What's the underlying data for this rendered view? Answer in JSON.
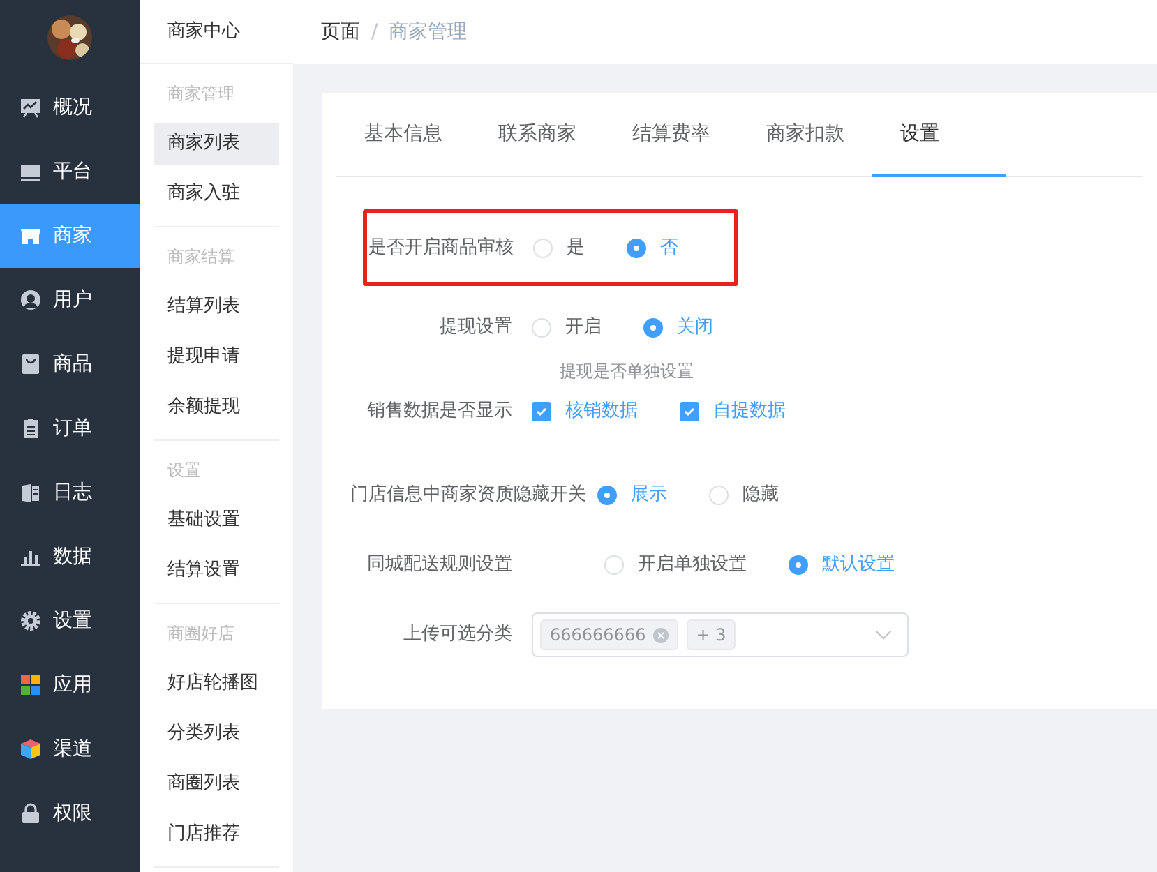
{
  "sidebar": {
    "items": [
      {
        "label": "概况",
        "selected": false
      },
      {
        "label": "平台",
        "selected": false
      },
      {
        "label": "商家",
        "selected": true
      },
      {
        "label": "用户",
        "selected": false
      },
      {
        "label": "商品",
        "selected": false
      },
      {
        "label": "订单",
        "selected": false
      },
      {
        "label": "日志",
        "selected": false
      },
      {
        "label": "数据",
        "selected": false
      },
      {
        "label": "设置",
        "selected": false
      },
      {
        "label": "应用",
        "selected": false
      },
      {
        "label": "渠道",
        "selected": false
      },
      {
        "label": "权限",
        "selected": false
      }
    ]
  },
  "submenu": {
    "title": "商家中心",
    "groups": [
      {
        "title": "商家管理",
        "items": [
          {
            "label": "商家列表",
            "selected": true
          },
          {
            "label": "商家入驻",
            "selected": false
          }
        ]
      },
      {
        "title": "商家结算",
        "items": [
          {
            "label": "结算列表",
            "selected": false
          },
          {
            "label": "提现申请",
            "selected": false
          },
          {
            "label": "余额提现",
            "selected": false
          }
        ]
      },
      {
        "title": "设置",
        "items": [
          {
            "label": "基础设置",
            "selected": false
          },
          {
            "label": "结算设置",
            "selected": false
          }
        ]
      },
      {
        "title": "商圈好店",
        "items": [
          {
            "label": "好店轮播图",
            "selected": false
          },
          {
            "label": "分类列表",
            "selected": false
          },
          {
            "label": "商圈列表",
            "selected": false
          },
          {
            "label": "门店推荐",
            "selected": false
          }
        ]
      }
    ]
  },
  "breadcrumb": {
    "separator": "/",
    "items": [
      "页面",
      "商家管理"
    ]
  },
  "tabs": [
    {
      "label": "基本信息",
      "selected": false
    },
    {
      "label": "联系商家",
      "selected": false
    },
    {
      "label": "结算费率",
      "selected": false
    },
    {
      "label": "商家扣款",
      "selected": false
    },
    {
      "label": "设置",
      "selected": true
    }
  ],
  "form": [
    {
      "kind": "radio",
      "label": "是否开启商品审核",
      "highlighted": true,
      "options": [
        {
          "label": "是",
          "selected": false
        },
        {
          "label": "否",
          "selected": true
        }
      ]
    },
    {
      "kind": "radio",
      "label": "提现设置",
      "highlighted": false,
      "hint": "提现是否单独设置",
      "options": [
        {
          "label": "开启",
          "selected": false
        },
        {
          "label": "关闭",
          "selected": true
        }
      ]
    },
    {
      "kind": "checkbox",
      "label": "销售数据是否显示",
      "highlighted": false,
      "options": [
        {
          "label": "核销数据",
          "checked": true
        },
        {
          "label": "自提数据",
          "checked": true
        }
      ]
    },
    {
      "kind": "radio",
      "label": "门店信息中商家资质隐藏开关",
      "highlighted": false,
      "options": [
        {
          "label": "展示",
          "selected": true
        },
        {
          "label": "隐藏",
          "selected": false
        }
      ]
    },
    {
      "kind": "radio",
      "label": "同城配送规则设置",
      "highlighted": false,
      "options": [
        {
          "label": "开启单独设置",
          "selected": false
        },
        {
          "label": "默认设置",
          "selected": true
        }
      ]
    },
    {
      "kind": "select",
      "label": "上传可选分类",
      "highlighted": false,
      "tags": [
        {
          "text": "666666666",
          "closable": true
        },
        {
          "text": "+ 3",
          "closable": false
        }
      ]
    }
  ]
}
